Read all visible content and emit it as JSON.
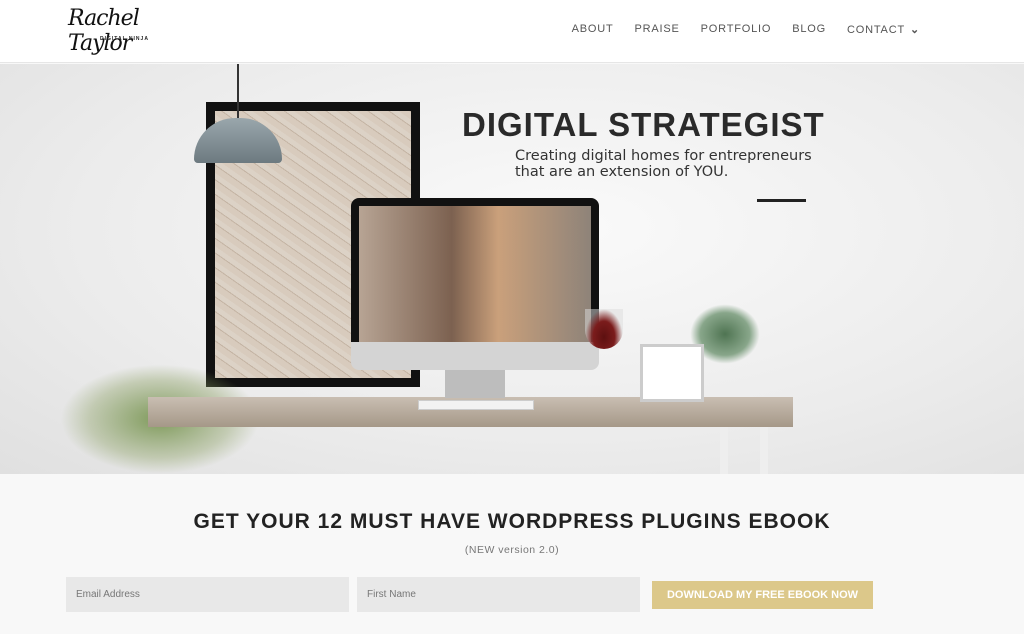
{
  "header": {
    "logo_text": "Rachel Taylor",
    "logo_subtitle": "DIGITAL NINJA",
    "nav": [
      {
        "label": "ABOUT"
      },
      {
        "label": "PRAISE"
      },
      {
        "label": "PORTFOLIO"
      },
      {
        "label": "BLOG"
      },
      {
        "label": "CONTACT",
        "icon": "chevron-down-icon"
      }
    ]
  },
  "hero": {
    "title": "DIGITAL STRATEGIST",
    "subtitle_line1": "Creating digital homes for entrepreneurs",
    "subtitle_line2": "that are an extension of YOU."
  },
  "cta": {
    "title": "GET YOUR 12 MUST HAVE WORDPRESS PLUGINS EBOOK",
    "subtitle": "(NEW version 2.0)",
    "email_placeholder": "Email Address",
    "name_placeholder": "First Name",
    "button_label": "DOWNLOAD MY FREE EBOOK NOW"
  },
  "colors": {
    "button": "#dcc88a",
    "input_bg": "#e8e8e8"
  }
}
